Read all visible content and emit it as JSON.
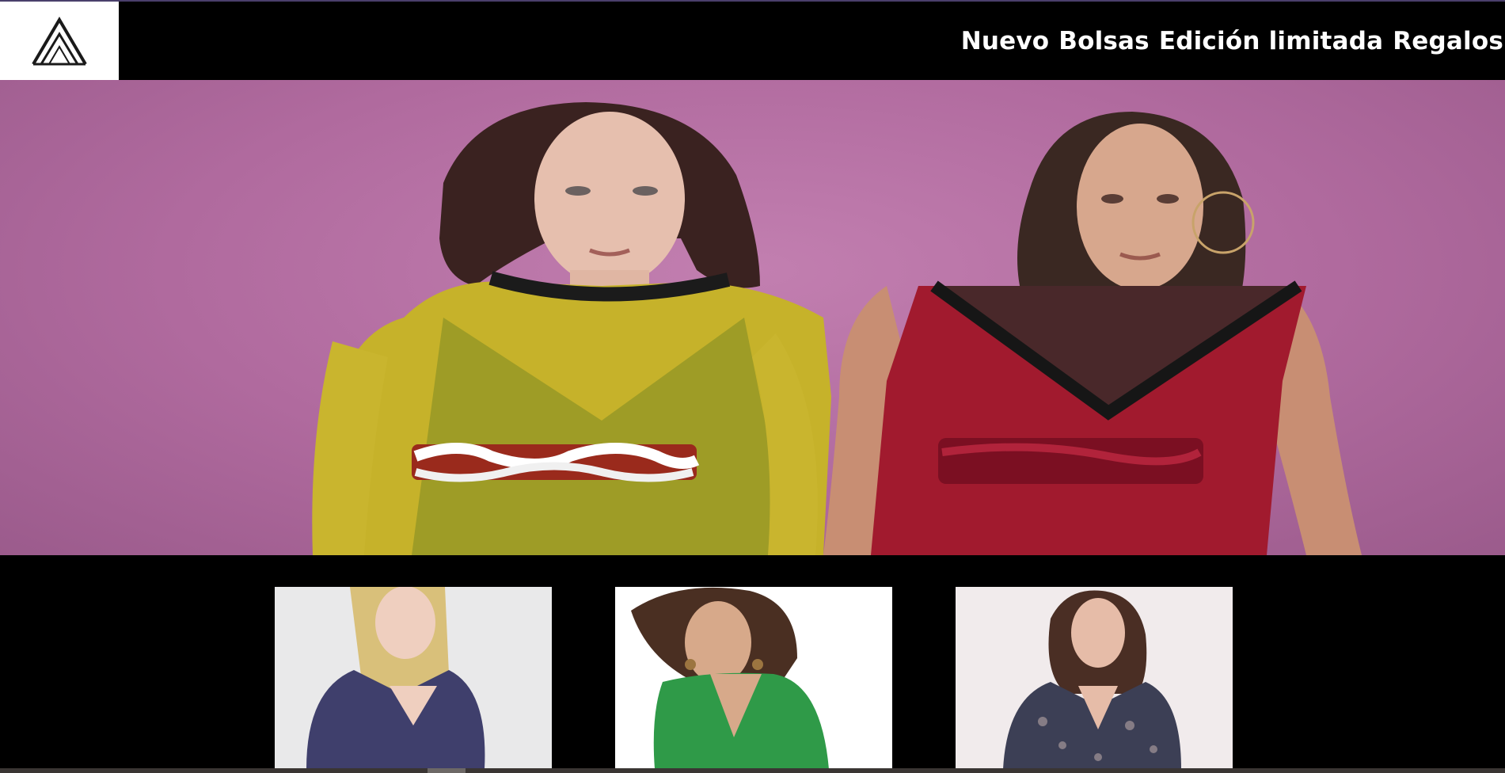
{
  "header": {
    "logo_alt": "A logo",
    "nav": [
      {
        "label": "Nuevo"
      },
      {
        "label": "Bolsas"
      },
      {
        "label": "Edición limitada"
      },
      {
        "label": "Regalos"
      }
    ]
  },
  "hero": {
    "icon": "fashion-models-image",
    "background_color": "#b872a6"
  },
  "products": [
    {
      "icon": "product-blouse-image",
      "color": "#4a4d7a"
    },
    {
      "icon": "product-green-dress-image",
      "color": "#2f9a48"
    },
    {
      "icon": "product-print-blouse-image",
      "color": "#3c3f55"
    }
  ]
}
